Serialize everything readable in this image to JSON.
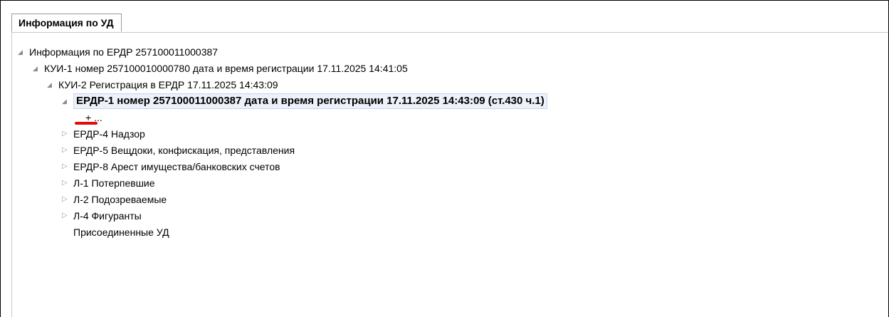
{
  "tab": {
    "label": "Информация по УД"
  },
  "tree": {
    "root_label": "Информация по ЕРДР 257100011000387",
    "kui1_label": "КУИ-1 номер 257100010000780 дата и время регистрации 17.11.2025 14:41:05",
    "kui2_label": "КУИ-2 Регистрация в ЕРДР 17.11.2025 14:43:09",
    "erdr1_label": "ЕРДР-1 номер 257100011000387 дата и время регистрации 17.11.2025 14:43:09 (ст.430 ч.1)",
    "erdr1_child_label": "+ ...",
    "items": [
      {
        "label": "ЕРДР-4 Надзор"
      },
      {
        "label": "ЕРДР-5 Вещдоки, конфискация, представления"
      },
      {
        "label": "ЕРДР-8 Арест имущества/банковских счетов"
      },
      {
        "label": "Л-1 Потерпевшие"
      },
      {
        "label": "Л-2 Подозреваемые"
      },
      {
        "label": "Л-4 Фигуранты"
      }
    ],
    "attached_label": "Присоединенные УД"
  },
  "icons": {
    "expanded": "triangle-expanded-icon",
    "collapsed": "triangle-collapsed-icon"
  },
  "colors": {
    "selection_background": "#eef1fa",
    "annotation_mark": "#e10b0b"
  }
}
